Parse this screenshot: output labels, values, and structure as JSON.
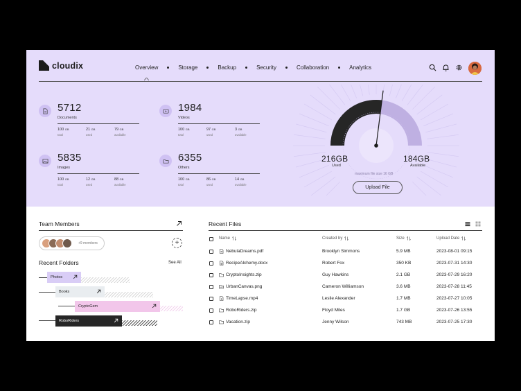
{
  "brand": {
    "name": "cloudix"
  },
  "nav": {
    "items": [
      "Overview",
      "Storage",
      "Backup",
      "Security",
      "Collaboration",
      "Analytics"
    ],
    "active": "Overview"
  },
  "header_icons": [
    "search-icon",
    "bell-icon",
    "gear-icon"
  ],
  "stats": [
    {
      "id": "documents",
      "icon": "document-icon",
      "count": "5712",
      "label": "Documents",
      "total": "100",
      "used": "21",
      "available": "79"
    },
    {
      "id": "videos",
      "icon": "video-icon",
      "count": "1984",
      "label": "Videos",
      "total": "100",
      "used": "97",
      "available": "3"
    },
    {
      "id": "images",
      "icon": "image-icon",
      "count": "5835",
      "label": "Images",
      "total": "100",
      "used": "12",
      "available": "88"
    },
    {
      "id": "others",
      "icon": "folder-icon",
      "count": "6355",
      "label": "Others",
      "total": "100",
      "used": "86",
      "available": "14"
    }
  ],
  "stat_units": {
    "unit": "GB",
    "total_caption": "total",
    "used_caption": "used",
    "available_caption": "available"
  },
  "storage": {
    "used_value": "216GB",
    "used_label": "Used",
    "available_value": "184GB",
    "available_label": "Available",
    "used_fraction": 0.54,
    "max_note": "maximum file size 16 GB",
    "upload_label": "Upload File"
  },
  "team": {
    "title": "Team Members",
    "more_label": "+9 members"
  },
  "folders": {
    "title": "Recent Folders",
    "see_all": "See All",
    "items": [
      "Photos",
      "Books",
      "CryptoGem",
      "RoboRiders"
    ]
  },
  "files": {
    "title": "Recent Files",
    "columns": {
      "name": "Name",
      "created_by": "Created by",
      "size": "Size",
      "upload_date": "Upload Date"
    },
    "rows": [
      {
        "name": "NebulaDreams.pdf",
        "icon": "pdf-file-icon",
        "created_by": "Brooklyn Simmons",
        "size": "5.9 MB",
        "date": "2023-08-01 09:15"
      },
      {
        "name": "RecipeAlchemy.docx",
        "icon": "doc-file-icon",
        "created_by": "Robert Fox",
        "size": "350 KB",
        "date": "2023-07-31 14:30"
      },
      {
        "name": "CryptoInsights.zip",
        "icon": "zip-file-icon",
        "created_by": "Guy Hawkins",
        "size": "2.1 GB",
        "date": "2023-07-29 16:20"
      },
      {
        "name": "UrbanCanvas.png",
        "icon": "image-file-icon",
        "created_by": "Cameron Williamson",
        "size": "3.6 MB",
        "date": "2023-07-28 11:45"
      },
      {
        "name": "TimeLapse.mp4",
        "icon": "video-file-icon",
        "created_by": "Leslie Alexander",
        "size": "1.7 MB",
        "date": "2023-07-27 10:05"
      },
      {
        "name": "RoboRiders.zip",
        "icon": "zip-file-icon",
        "created_by": "Floyd Miles",
        "size": "1.7 GB",
        "date": "2023-07-26 13:55"
      },
      {
        "name": "Vacation.zip",
        "icon": "zip-file-icon",
        "created_by": "Jenny Wilson",
        "size": "743 MB",
        "date": "2023-07-25 17:30"
      }
    ]
  }
}
